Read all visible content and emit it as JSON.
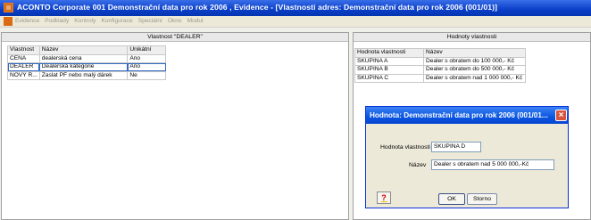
{
  "window": {
    "title": "ACONTO Corporate 001 Demonstrační data pro rok 2006 , Evidence - [Vlastnosti adres: Demonstrační data pro rok 2006  (001/01)]"
  },
  "menu": {
    "items": [
      "Evidence",
      "Podklady",
      "Kontroly",
      "Konfigurace",
      "Speciální",
      "Okno",
      "Modul"
    ]
  },
  "left_panel": {
    "header": "Vlastnost \"DEALER\"",
    "columns": [
      "Vlastnost",
      "Název",
      "Unikátní"
    ],
    "rows": [
      [
        "CENA",
        "dealerská cena",
        "Ano"
      ],
      [
        "DEALER",
        "Dealerská kategorie",
        "Ano"
      ],
      [
        "NOVÝ R...",
        "Zaslat PF nebo malý dárek",
        "Ne"
      ]
    ]
  },
  "right_panel": {
    "header": "Hodnoty vlastnosti",
    "columns": [
      "Hodnota vlastnosti",
      "Název"
    ],
    "rows": [
      [
        "SKUPINA  A",
        "Dealer s obratem do 100 000,- Kč"
      ],
      [
        "SKUPINA  B",
        "Dealer s obratem do 500 000,- Kč"
      ],
      [
        "SKUPINA  C",
        "Dealer s obratem nad 1 000 000,- Kč"
      ]
    ]
  },
  "dialog": {
    "title": "Hodnota: Demonstrační data pro rok 2006  (001/01...",
    "value_label": "Hodnota vlastnosti",
    "value": "SKUPINA D",
    "name_label": "Název",
    "name": "Dealer s obratem nad 5 000 000,-Kč",
    "help_label": "?",
    "ok_label": "OK",
    "cancel_label": "Storno"
  }
}
